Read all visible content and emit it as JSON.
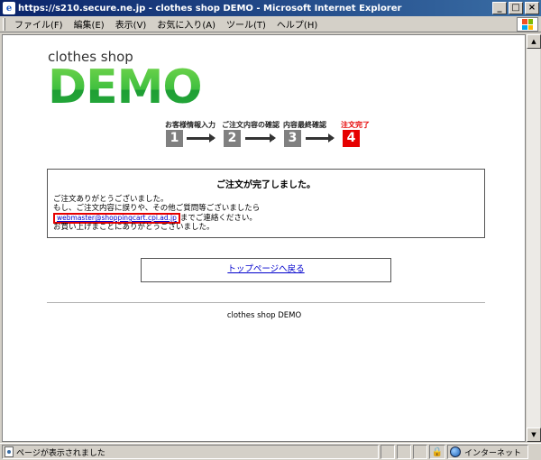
{
  "window": {
    "title": "https://s210.secure.ne.jp - clothes shop DEMO - Microsoft Internet Explorer",
    "buttons": {
      "minimize": "_",
      "maximize": "□",
      "close": "×"
    }
  },
  "menu": [
    {
      "label": "ファイル(F)"
    },
    {
      "label": "編集(E)"
    },
    {
      "label": "表示(V)"
    },
    {
      "label": "お気に入り(A)"
    },
    {
      "label": "ツール(T)"
    },
    {
      "label": "ヘルプ(H)"
    }
  ],
  "logo": {
    "small": "clothes shop",
    "big": "DEMO",
    "colors": {
      "green": "#3cb43c"
    }
  },
  "steps": [
    {
      "label": "お客様情報入力",
      "num": "1",
      "active": false
    },
    {
      "label": "ご注文内容の確認",
      "num": "2",
      "active": false
    },
    {
      "label": "内容最終確認",
      "num": "3",
      "active": false
    },
    {
      "label": "注文完了",
      "num": "4",
      "active": true
    }
  ],
  "done": {
    "title": "ご注文が完了しました。",
    "line1": "ご注文ありがとうございました。",
    "line2": "もし、ご注文内容に誤りや、その他ご質問等ございましたら",
    "email": "webmaster@shoppingcart.cpi.ad.jp",
    "line3_suffix": "までご連絡ください。",
    "line4": "お買い上げまことにありがとうございました。"
  },
  "back_link": "トップページへ戻る",
  "footer": "clothes shop DEMO",
  "status": {
    "text": "ページが表示されました",
    "zone": "インターネット"
  },
  "colors": {
    "accent_red": "#e60000",
    "link": "#0000cc"
  }
}
